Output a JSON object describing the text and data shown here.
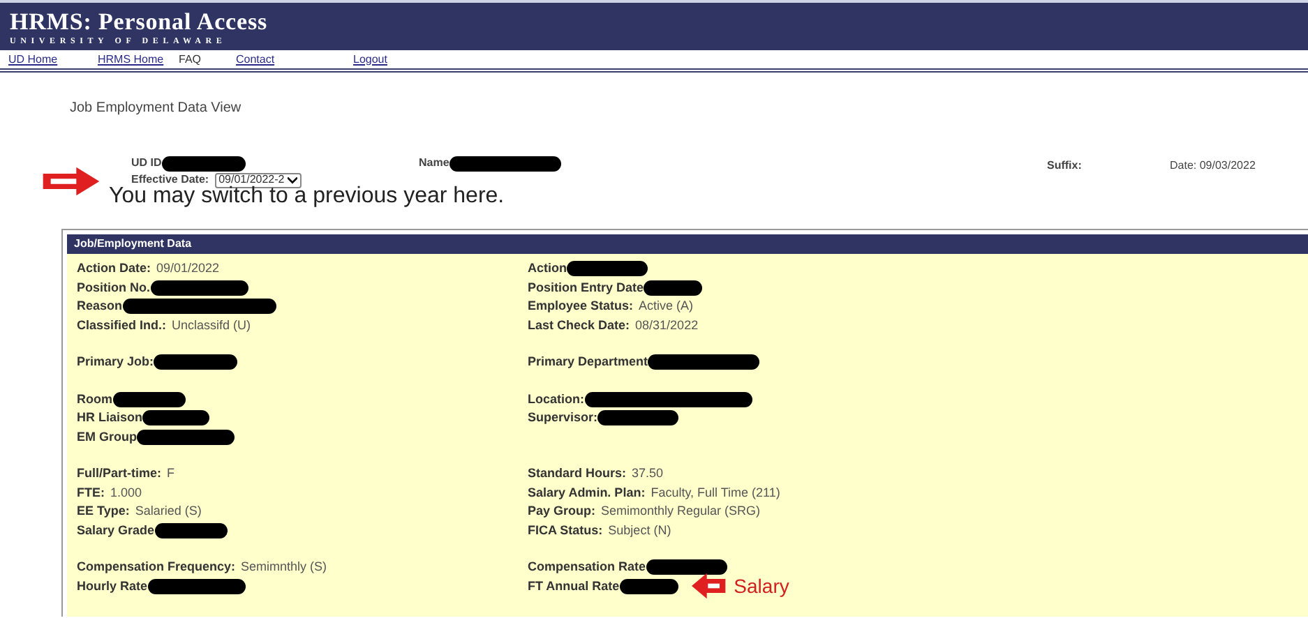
{
  "header": {
    "title": "HRMS: Personal Access",
    "subtitle": "UNIVERSITY OF DELAWARE"
  },
  "nav": [
    "UD Home",
    "HRMS Home",
    "FAQ",
    "Contact",
    "Logout"
  ],
  "page_title": "Job Employment Data View",
  "identity": {
    "ud_id_label": "UD ID",
    "name_label": "Name",
    "suffix_label": "Suffix:",
    "date_label": "Date:",
    "date_value": "09/03/2022",
    "effective_date_label": "Effective Date:",
    "effective_date_value": "09/01/2022-2"
  },
  "annotation": "You may switch to a previous year here.",
  "panel": {
    "title": "Job/Employment Data",
    "sections": [
      {
        "rows": [
          {
            "left": {
              "label": "Action Date:",
              "value": "09/01/2022"
            },
            "right": {
              "label": "Action",
              "redacted": true
            }
          },
          {
            "left": {
              "label": "Position No.",
              "redacted": true
            },
            "right": {
              "label": "Position Entry Date",
              "redacted": true
            }
          },
          {
            "left": {
              "label": "Reason",
              "redacted": true
            },
            "right": {
              "label": "Employee Status:",
              "value": "Active (A)"
            }
          },
          {
            "left": {
              "label": "Classified Ind.:",
              "value": "Unclassifd (U)"
            },
            "right": {
              "label": "Last Check Date:",
              "value": "08/31/2022"
            }
          }
        ]
      },
      {
        "rows": [
          {
            "left": {
              "label": "Primary Job:",
              "redacted": true
            },
            "right": {
              "label": "Primary Department",
              "redacted": true
            }
          }
        ]
      },
      {
        "rows": [
          {
            "left": {
              "label": "Room",
              "redacted": true
            },
            "right": {
              "label": "Location:",
              "redacted": true
            }
          },
          {
            "left": {
              "label": "HR Liaison",
              "redacted": true
            },
            "right": {
              "label": "Supervisor:",
              "redacted": true
            }
          },
          {
            "left": {
              "label": "EM Group",
              "redacted": true
            }
          }
        ]
      },
      {
        "rows": [
          {
            "left": {
              "label": "Full/Part-time:",
              "value": "F"
            },
            "right": {
              "label": "Standard Hours:",
              "value": "37.50"
            }
          },
          {
            "left": {
              "label": "FTE:",
              "value": "1.000"
            },
            "right": {
              "label": "Salary Admin. Plan:",
              "value": "Faculty, Full Time (211)"
            }
          },
          {
            "left": {
              "label": "EE Type:",
              "value": "Salaried (S)"
            },
            "right": {
              "label": "Pay Group:",
              "value": "Semimonthly Regular (SRG)"
            }
          },
          {
            "left": {
              "label": "Salary Grade",
              "redacted": true
            },
            "right": {
              "label": "FICA Status:",
              "value": "Subject (N)"
            }
          }
        ]
      },
      {
        "rows": [
          {
            "left": {
              "label": "Compensation Frequency:",
              "value": "Semimnthly (S)"
            },
            "right": {
              "label": "Compensation Rate",
              "redacted": true
            }
          },
          {
            "left": {
              "label": "Hourly Rate",
              "redacted": true
            },
            "right": {
              "label": "FT Annual Rate",
              "redacted": true,
              "note": "Salary"
            }
          }
        ]
      }
    ]
  }
}
